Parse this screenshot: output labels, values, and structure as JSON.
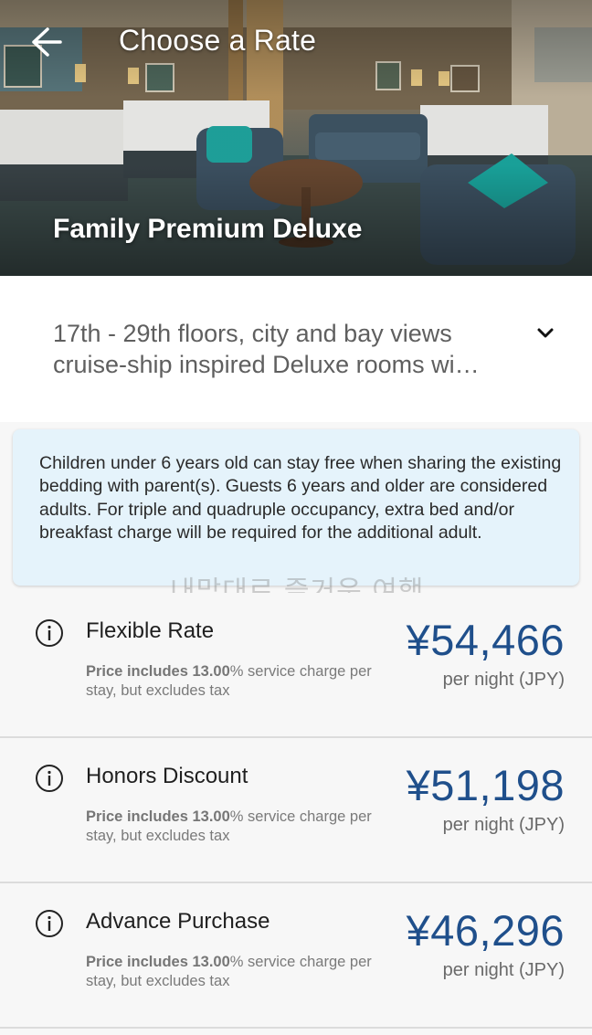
{
  "header": {
    "title": "Choose a Rate",
    "room_name": "Family Premium Deluxe"
  },
  "description": {
    "line1": "17th - 29th floors, city and bay views",
    "line2": "cruise-ship inspired Deluxe rooms wi…"
  },
  "notice": {
    "text": "Children under 6 years old can stay free when sharing the existing bedding with parent(s). Guests 6 years and older are considered adults. For triple and quadruple occupancy, extra bed and/or breakfast charge will be required for the additional adult."
  },
  "watermark": "내맘대로 즐거운 여행",
  "rates": [
    {
      "name": "Flexible Rate",
      "note_bold": "Price includes 13.00",
      "note_rest": "% service charge per stay, but excludes tax",
      "price": "¥54,466",
      "unit": "per night (JPY)"
    },
    {
      "name": "Honors Discount",
      "note_bold": "Price includes 13.00",
      "note_rest": "% service charge per stay, but excludes tax",
      "price": "¥51,198",
      "unit": "per night (JPY)"
    },
    {
      "name": "Advance Purchase",
      "note_bold": "Price includes 13.00",
      "note_rest": "% service charge per stay, but excludes tax",
      "price": "¥46,296",
      "unit": "per night (JPY)"
    }
  ],
  "colors": {
    "price": "#1f4f8b",
    "notice_bg": "#e5f3fb",
    "list_bg": "#f7f7f7"
  },
  "icons": [
    "back-arrow-icon",
    "chevron-down-icon",
    "info-icon"
  ]
}
